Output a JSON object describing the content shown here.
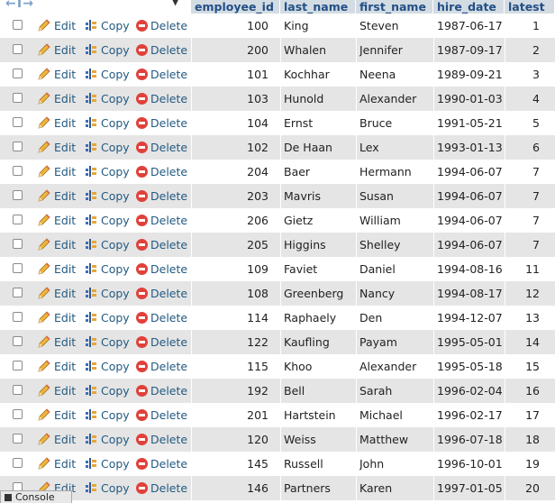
{
  "table": {
    "headers": {
      "employee_id": "employee_id",
      "last_name": "last_name",
      "first_name": "first_name",
      "hire_date": "hire_date",
      "latest": "latest"
    },
    "actions": {
      "edit": "Edit",
      "copy": "Copy",
      "delete": "Delete"
    },
    "rows": [
      {
        "employee_id": "100",
        "last_name": "King",
        "first_name": "Steven",
        "hire_date": "1987-06-17",
        "latest": "1"
      },
      {
        "employee_id": "200",
        "last_name": "Whalen",
        "first_name": "Jennifer",
        "hire_date": "1987-09-17",
        "latest": "2"
      },
      {
        "employee_id": "101",
        "last_name": "Kochhar",
        "first_name": "Neena",
        "hire_date": "1989-09-21",
        "latest": "3"
      },
      {
        "employee_id": "103",
        "last_name": "Hunold",
        "first_name": "Alexander",
        "hire_date": "1990-01-03",
        "latest": "4"
      },
      {
        "employee_id": "104",
        "last_name": "Ernst",
        "first_name": "Bruce",
        "hire_date": "1991-05-21",
        "latest": "5"
      },
      {
        "employee_id": "102",
        "last_name": "De Haan",
        "first_name": "Lex",
        "hire_date": "1993-01-13",
        "latest": "6"
      },
      {
        "employee_id": "204",
        "last_name": "Baer",
        "first_name": "Hermann",
        "hire_date": "1994-06-07",
        "latest": "7"
      },
      {
        "employee_id": "203",
        "last_name": "Mavris",
        "first_name": "Susan",
        "hire_date": "1994-06-07",
        "latest": "7"
      },
      {
        "employee_id": "206",
        "last_name": "Gietz",
        "first_name": "William",
        "hire_date": "1994-06-07",
        "latest": "7"
      },
      {
        "employee_id": "205",
        "last_name": "Higgins",
        "first_name": "Shelley",
        "hire_date": "1994-06-07",
        "latest": "7"
      },
      {
        "employee_id": "109",
        "last_name": "Faviet",
        "first_name": "Daniel",
        "hire_date": "1994-08-16",
        "latest": "11"
      },
      {
        "employee_id": "108",
        "last_name": "Greenberg",
        "first_name": "Nancy",
        "hire_date": "1994-08-17",
        "latest": "12"
      },
      {
        "employee_id": "114",
        "last_name": "Raphaely",
        "first_name": "Den",
        "hire_date": "1994-12-07",
        "latest": "13"
      },
      {
        "employee_id": "122",
        "last_name": "Kaufling",
        "first_name": "Payam",
        "hire_date": "1995-05-01",
        "latest": "14"
      },
      {
        "employee_id": "115",
        "last_name": "Khoo",
        "first_name": "Alexander",
        "hire_date": "1995-05-18",
        "latest": "15"
      },
      {
        "employee_id": "192",
        "last_name": "Bell",
        "first_name": "Sarah",
        "hire_date": "1996-02-04",
        "latest": "16"
      },
      {
        "employee_id": "201",
        "last_name": "Hartstein",
        "first_name": "Michael",
        "hire_date": "1996-02-17",
        "latest": "17"
      },
      {
        "employee_id": "120",
        "last_name": "Weiss",
        "first_name": "Matthew",
        "hire_date": "1996-07-18",
        "latest": "18"
      },
      {
        "employee_id": "145",
        "last_name": "Russell",
        "first_name": "John",
        "hire_date": "1996-10-01",
        "latest": "19"
      },
      {
        "employee_id": "146",
        "last_name": "Partners",
        "first_name": "Karen",
        "hire_date": "1997-01-05",
        "latest": "20"
      }
    ]
  },
  "console": {
    "label": "Console"
  },
  "colors": {
    "header_bg": "#d3dce3",
    "header_text": "#234f86",
    "link": "#235a81",
    "row_alt": "#e5e5e5",
    "delete_icon": "#e0413a"
  }
}
